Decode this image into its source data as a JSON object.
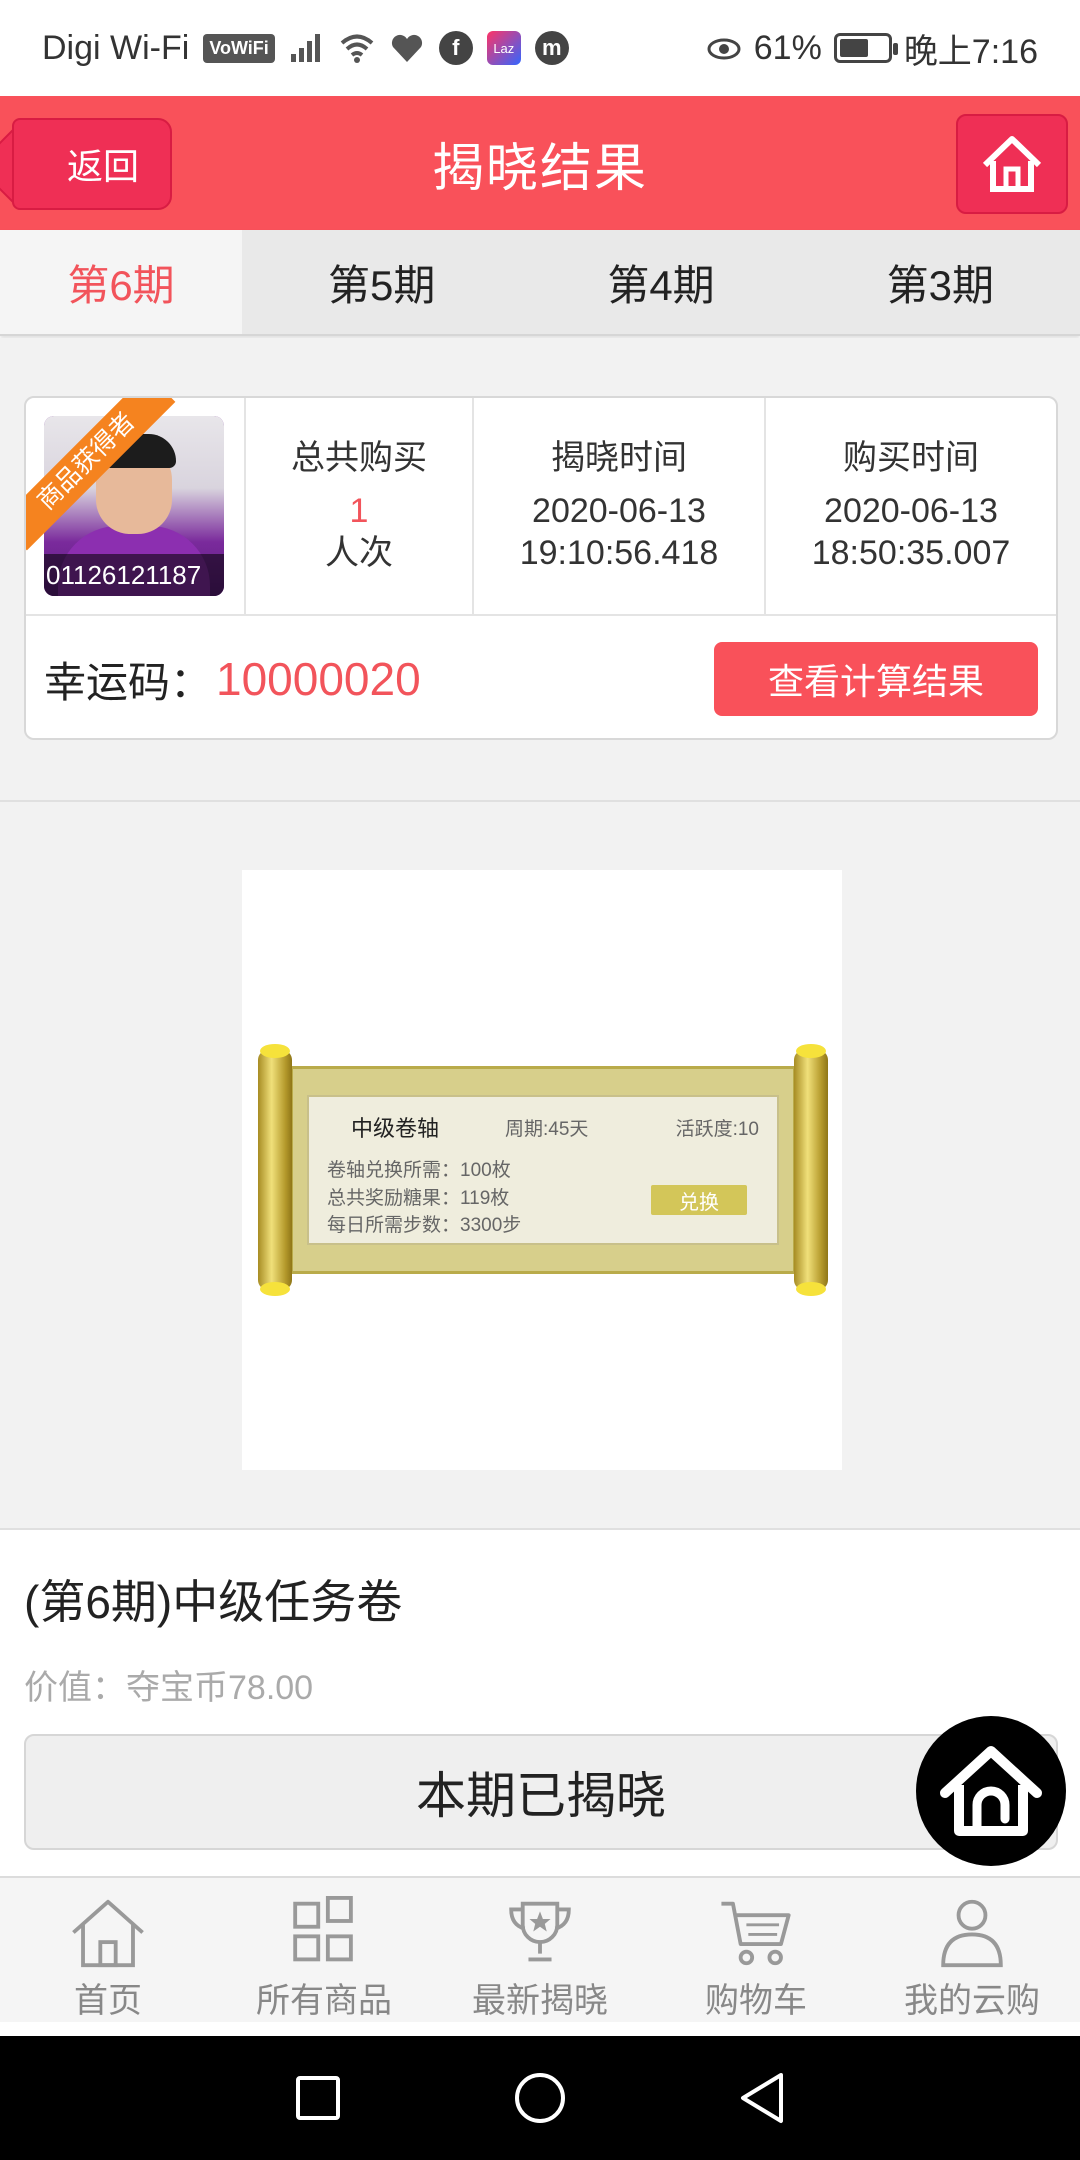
{
  "status_bar": {
    "carrier": "Digi Wi-Fi",
    "vowifi": "VoWiFi",
    "laz": "Laz",
    "app_m": "m",
    "battery_pct": "61%",
    "battery_level": 0.61,
    "time": "晚上7:16"
  },
  "header": {
    "back_label": "返回",
    "title": "揭晓结果"
  },
  "tabs": [
    {
      "label": "第6期",
      "active": true
    },
    {
      "label": "第5期",
      "active": false
    },
    {
      "label": "第4期",
      "active": false
    },
    {
      "label": "第3期",
      "active": false
    }
  ],
  "winner": {
    "ribbon": "商品获得者",
    "user_id": "01126121187",
    "total_buy_label": "总共购买",
    "total_buy_count": "1",
    "total_buy_unit": "人次",
    "reveal_label": "揭晓时间",
    "reveal_date": "2020-06-13",
    "reveal_time": "19:10:56.418",
    "purchase_label": "购买时间",
    "purchase_date": "2020-06-13",
    "purchase_time": "18:50:35.007",
    "lucky_label": "幸运码：",
    "lucky_code": "10000020",
    "calc_button": "查看计算结果"
  },
  "product_image": {
    "scroll_title": "中级卷轴",
    "cycle": "周期:45天",
    "activity": "活跃度:10",
    "line1": "卷轴兑换所需：100枚",
    "line2": "总共奖励糖果：119枚",
    "line3": "每日所需步数：3300步",
    "exchange": "兑换"
  },
  "product": {
    "title": "(第6期)中级任务卷",
    "value": "价值：夺宝币78.00",
    "status_button": "本期已揭晓"
  },
  "bottom_nav": [
    {
      "label": "首页",
      "icon": "home-icon"
    },
    {
      "label": "所有商品",
      "icon": "grid-icon"
    },
    {
      "label": "最新揭晓",
      "icon": "trophy-icon"
    },
    {
      "label": "购物车",
      "icon": "cart-icon"
    },
    {
      "label": "我的云购",
      "icon": "user-icon"
    }
  ],
  "colors": {
    "brand_red": "#f9515a",
    "accent_red": "#f2545b",
    "ribbon_orange": "#f5831f"
  }
}
